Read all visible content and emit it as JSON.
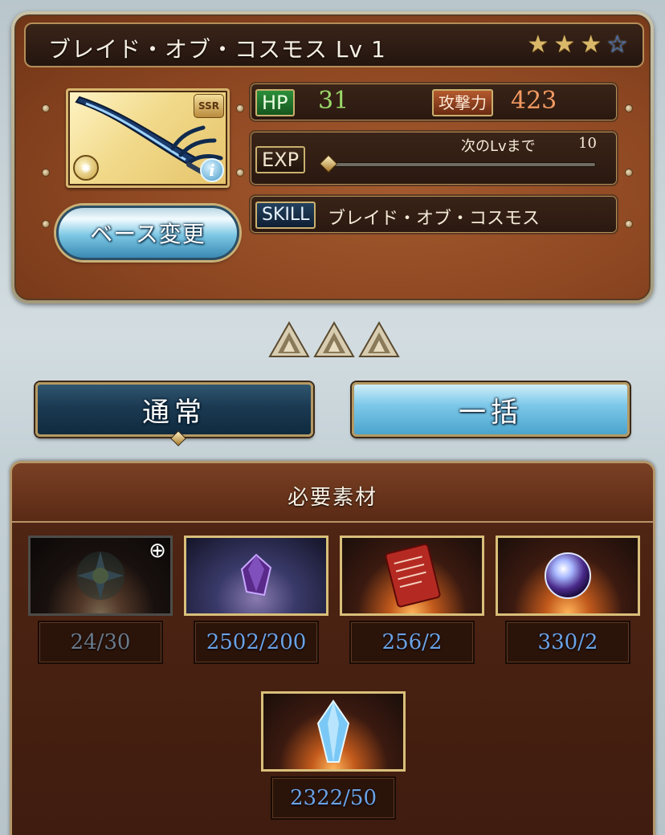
{
  "weapon": {
    "title": "ブレイド・オブ・コスモス Lv 1",
    "stars_filled": 3,
    "stars_total": 4,
    "rarity_badge": "SSR",
    "base_change_label": "ベース変更",
    "info_icon_label": "i"
  },
  "stats": {
    "hp_label": "HP",
    "hp_value": "31",
    "atk_label": "攻撃力",
    "atk_value": "423",
    "exp_label": "EXP",
    "next_lv_label": "次のLvまで",
    "next_lv_value": "10",
    "exp_progress": 0,
    "skill_label": "SKILL",
    "skill_name": "ブレイド・オブ・コスモス"
  },
  "modes": {
    "normal_label": "通常",
    "bulk_label": "一括"
  },
  "materials": {
    "title": "必要素材",
    "items": [
      {
        "count": "24/30",
        "icon": "green-crystal-flower-icon",
        "available": false,
        "zoom": true
      },
      {
        "count": "2502/200",
        "icon": "purple-gem-icon",
        "available": true,
        "zoom": false
      },
      {
        "count": "256/2",
        "icon": "red-scroll-icon",
        "available": true,
        "zoom": false
      },
      {
        "count": "330/2",
        "icon": "cosmic-orb-icon",
        "available": true,
        "zoom": false
      },
      {
        "count": "2322/50",
        "icon": "blue-crystal-icon",
        "available": true,
        "zoom": false
      }
    ]
  },
  "colors": {
    "panel_brown": "#8c4621",
    "hp_green": "#9bd86a",
    "atk_orange": "#f39a62",
    "count_blue": "#6aa2e6",
    "star_gold": "#d9b86a",
    "star_empty_blue": "#3b6fb5"
  }
}
